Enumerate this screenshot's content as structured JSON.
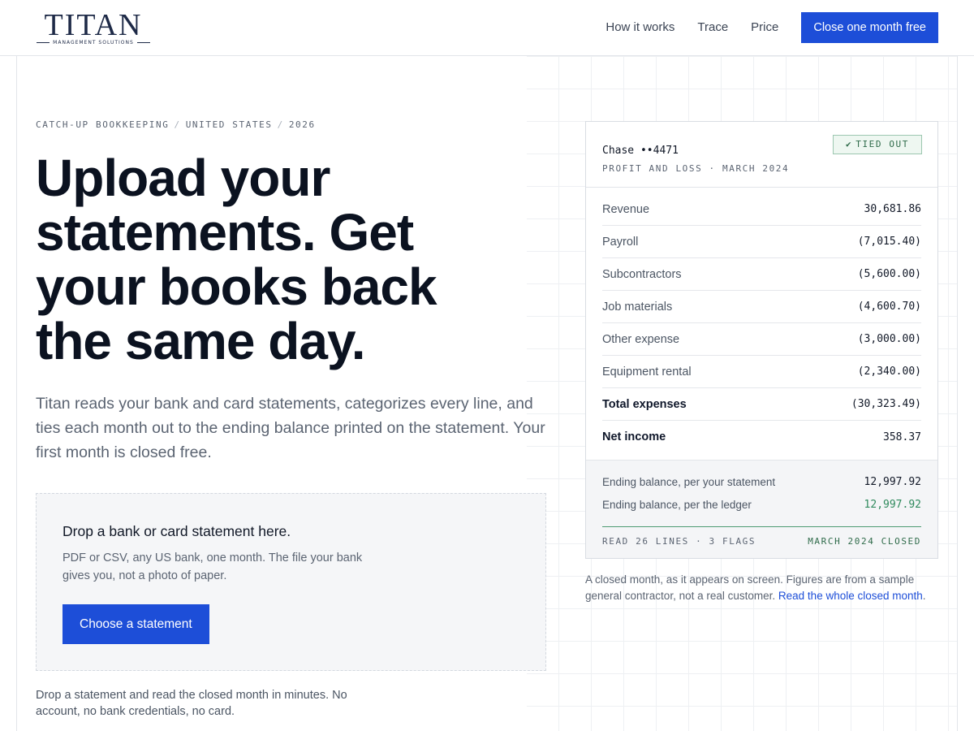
{
  "header": {
    "logo": {
      "wordmark": "TITAN",
      "tagline": "MANAGEMENT SOLUTIONS"
    },
    "nav": [
      {
        "label": "How it works"
      },
      {
        "label": "Trace"
      },
      {
        "label": "Price"
      }
    ],
    "cta_label": "Close one month free"
  },
  "hero": {
    "eyebrow": [
      "CATCH-UP BOOKKEEPING",
      "UNITED STATES",
      "2026"
    ],
    "headline_lines": [
      "Upload your",
      "statements. Get",
      "your books back",
      "the same day."
    ],
    "lede": "Titan reads your bank and card statements, categorizes every line, and ties each month out to the ending balance printed on the statement. Your first month is closed free."
  },
  "dropzone": {
    "title": "Drop a bank or card statement here.",
    "text": "PDF or CSV, any US bank, one month. The file your bank gives you, not a photo of paper.",
    "button_label": "Choose a statement"
  },
  "footnote": "Drop a statement and read the closed month in minutes. No account, no bank credentials, no card.",
  "card": {
    "account": "Chase ••4471",
    "period": "PROFIT AND LOSS · MARCH 2024",
    "badge": "TIED OUT",
    "rows": [
      {
        "label": "Revenue",
        "value": "30,681.86"
      },
      {
        "label": "Payroll",
        "value": "(7,015.40)"
      },
      {
        "label": "Subcontractors",
        "value": "(5,600.00)"
      },
      {
        "label": "Job materials",
        "value": "(4,600.70)"
      },
      {
        "label": "Other expense",
        "value": "(3,000.00)"
      },
      {
        "label": "Equipment rental",
        "value": "(2,340.00)"
      },
      {
        "label": "Total expenses",
        "value": "(30,323.49)"
      },
      {
        "label": "Net income",
        "value": "358.37"
      }
    ],
    "balance_statement": {
      "label": "Ending balance, per your statement",
      "value": "12,997.92"
    },
    "balance_ledger": {
      "label": "Ending balance, per the ledger",
      "value": "12,997.92"
    },
    "footer_left": "READ 26 LINES · 3 FLAGS",
    "footer_right": "MARCH 2024 CLOSED"
  },
  "caption": {
    "text": "A closed month, as it appears on screen. Figures are from a sample general contractor, not a real customer.",
    "link": "Read the whole closed month",
    "end": "."
  },
  "colors": {
    "accent": "#1d4ed8",
    "brand_navy": "#1e2a47",
    "success_green": "#2f8a5d"
  }
}
